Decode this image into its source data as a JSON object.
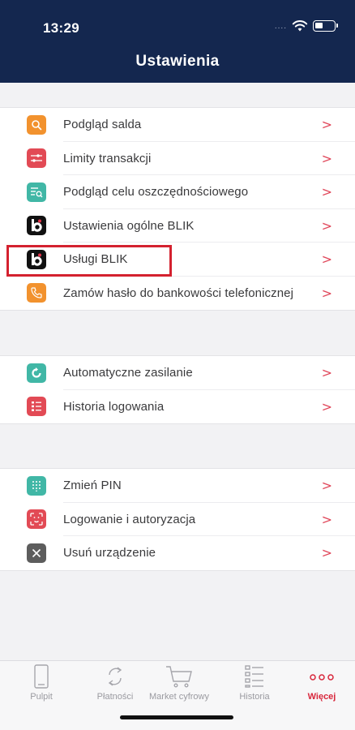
{
  "status_bar": {
    "time": "13:29",
    "signal": "....",
    "wifi_icon": "wifi-icon",
    "battery_icon": "battery-icon"
  },
  "header": {
    "title": "Ustawienia"
  },
  "groups": [
    {
      "items": [
        {
          "label": "Podgląd salda",
          "icon": "search-icon",
          "color": "#f2922e"
        },
        {
          "label": "Limity transakcji",
          "icon": "limits-icon",
          "color": "#e24a55"
        },
        {
          "label": "Podgląd celu oszczędnościowego",
          "icon": "savings-goal-icon",
          "color": "#41b7a6"
        },
        {
          "label": "Ustawienia ogólne BLIK",
          "icon": "blik-logo-icon",
          "color": "#111111"
        },
        {
          "label": "Usługi BLIK",
          "icon": "blik-logo-icon",
          "color": "#111111"
        },
        {
          "label": "Zamów hasło do bankowości telefonicznej",
          "icon": "phone-icon",
          "color": "#f2922e"
        }
      ]
    },
    {
      "items": [
        {
          "label": "Automatyczne zasilanie",
          "icon": "refresh-icon",
          "color": "#41b7a6"
        },
        {
          "label": "Historia logowania",
          "icon": "list-icon",
          "color": "#e24a55"
        }
      ]
    },
    {
      "items": [
        {
          "label": "Zmień PIN",
          "icon": "keypad-icon",
          "color": "#41b7a6"
        },
        {
          "label": "Logowanie i autoryzacja",
          "icon": "face-id-icon",
          "color": "#e24a55"
        },
        {
          "label": "Usuń urządzenie",
          "icon": "close-icon",
          "color": "#5d5d5d"
        }
      ]
    }
  ],
  "chevron": ">",
  "highlighted_item": "Usługi BLIK",
  "tabs": [
    {
      "label": "Pulpit",
      "icon": "phone-device-icon",
      "active": false
    },
    {
      "label": "Płatności",
      "icon": "transfer-arrows-icon",
      "active": false
    },
    {
      "label": "Market cyfrowy",
      "icon": "cart-icon",
      "active": false
    },
    {
      "label": "Historia",
      "icon": "history-list-icon",
      "active": false
    },
    {
      "label": "Więcej",
      "icon": "more-dots-icon",
      "active": true
    }
  ],
  "colors": {
    "header_bg": "#14274f",
    "accent": "#d8263b",
    "highlight_border": "#d4212f"
  }
}
